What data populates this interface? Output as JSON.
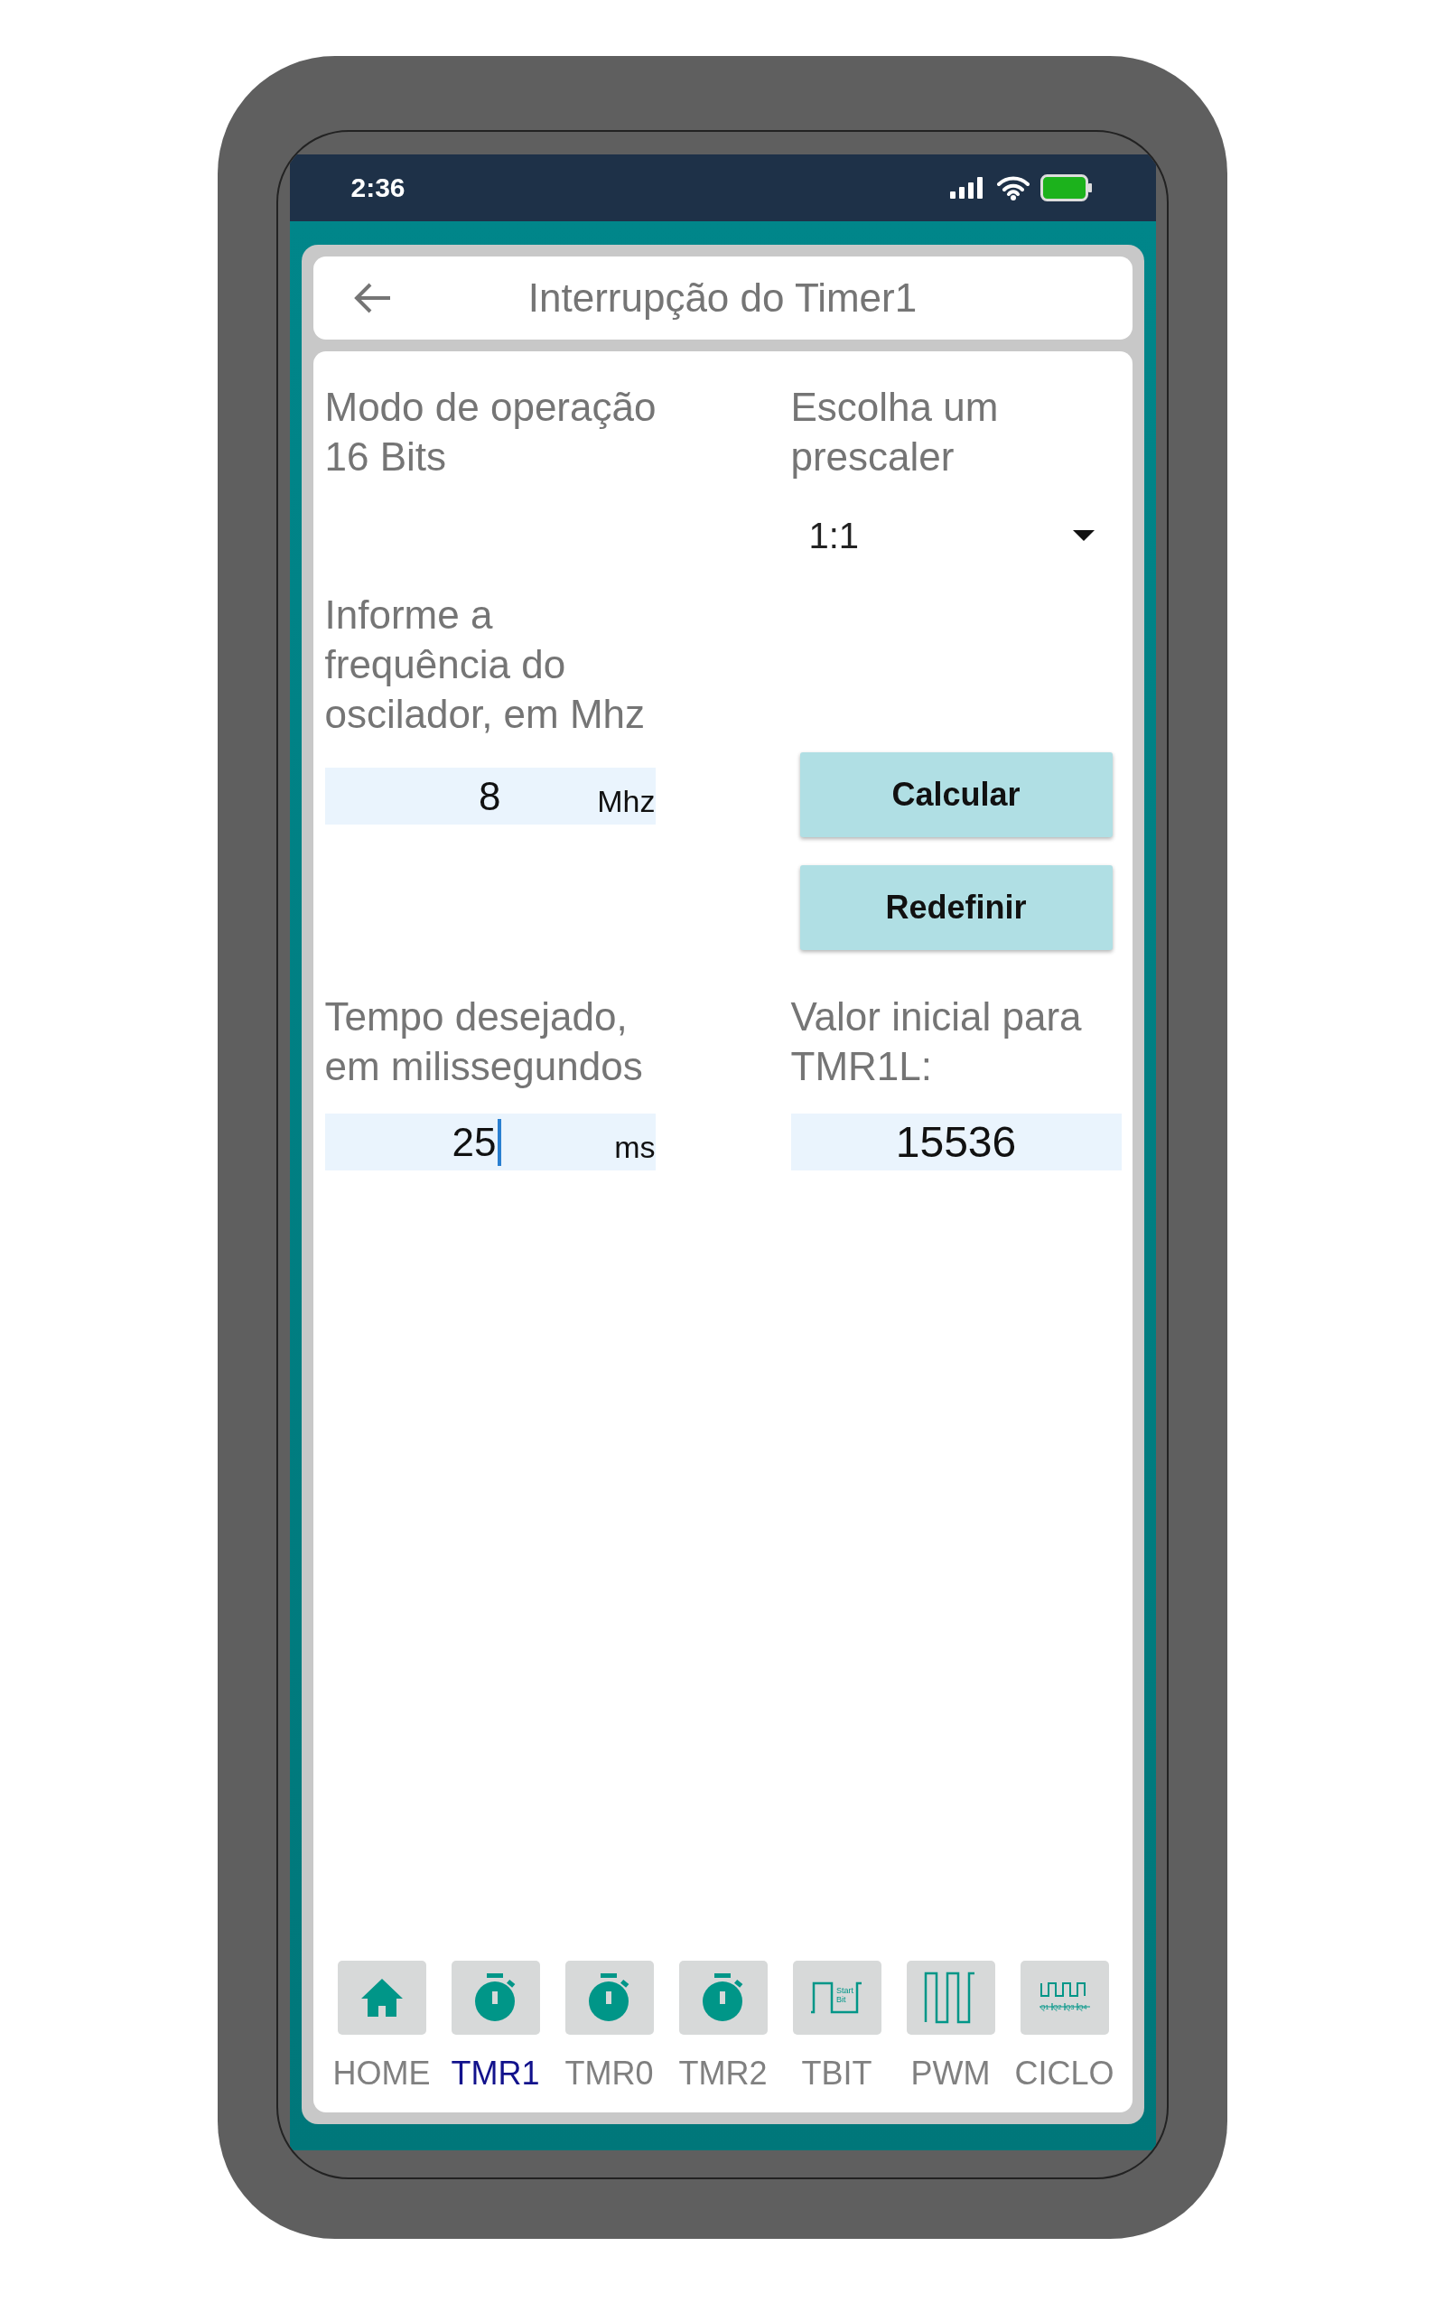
{
  "status_bar": {
    "time": "2:36"
  },
  "header": {
    "title": "Interrupção do Timer1"
  },
  "form": {
    "mode_label": "Modo de operação 16 Bits",
    "prescaler_label": "Escolha um prescaler",
    "prescaler": {
      "value": "1:1"
    },
    "frequency_label": "Informe a frequência do oscilador, em Mhz",
    "frequency": {
      "value": "8",
      "unit": "Mhz",
      "focused": false
    },
    "buttons": [
      "Calcular",
      "Redefinir"
    ],
    "time_label": "Tempo desejado, em milissegundos",
    "time": {
      "value": "25",
      "unit": "ms",
      "focused": true
    },
    "result_label": "Valor inicial para TMR1L:",
    "result": {
      "value": "15536"
    }
  },
  "bottom_nav": [
    {
      "kind": "home",
      "label": "HOME",
      "selected": false
    },
    {
      "kind": "stopwatch",
      "label": "TMR1",
      "selected": true
    },
    {
      "kind": "stopwatch",
      "label": "TMR0",
      "selected": false
    },
    {
      "kind": "stopwatch",
      "label": "TMR2",
      "selected": false
    },
    {
      "kind": "start-bit",
      "label": "TBIT",
      "selected": false,
      "icon_text": [
        "Start",
        "Bit"
      ]
    },
    {
      "kind": "pwm",
      "label": "PWM",
      "selected": false
    },
    {
      "kind": "cycle",
      "label": "CICLO",
      "selected": false,
      "icon_text": [
        "Q1",
        "Q2",
        "Q3",
        "Q4"
      ]
    }
  ]
}
